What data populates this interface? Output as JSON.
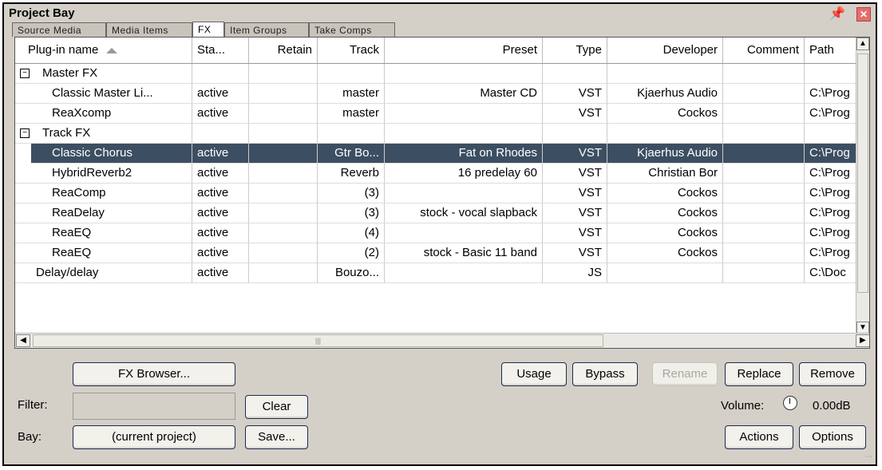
{
  "window": {
    "title": "Project Bay"
  },
  "tabs": [
    "Source Media",
    "Media Items",
    "FX",
    "Item Groups",
    "Take Comps"
  ],
  "columns": [
    "Plug-in name",
    "Sta...",
    "Retain",
    "Track",
    "Preset",
    "Type",
    "Developer",
    "Comment",
    "Path"
  ],
  "rows": [
    {
      "kind": "group",
      "name": "Master FX"
    },
    {
      "kind": "item",
      "name": "Classic Master Li...",
      "status": "active",
      "retain": "",
      "track": "master",
      "preset": "Master CD",
      "type": "VST",
      "developer": "Kjaerhus Audio",
      "comment": "",
      "path": "C:\\Prog"
    },
    {
      "kind": "item",
      "name": "ReaXcomp",
      "status": "active",
      "retain": "",
      "track": "master",
      "preset": "",
      "type": "VST",
      "developer": "Cockos",
      "comment": "",
      "path": "C:\\Prog"
    },
    {
      "kind": "group",
      "name": "Track FX"
    },
    {
      "kind": "item",
      "name": "Classic Chorus",
      "status": "active",
      "retain": "",
      "track": "Gtr Bo...",
      "preset": "Fat on Rhodes",
      "type": "VST",
      "developer": "Kjaerhus Audio",
      "comment": "",
      "path": "C:\\Prog",
      "selected": true
    },
    {
      "kind": "item",
      "name": "HybridReverb2",
      "status": "active",
      "retain": "",
      "track": "Reverb",
      "preset": "16 predelay 60",
      "type": "VST",
      "developer": "Christian Bor",
      "comment": "",
      "path": "C:\\Prog"
    },
    {
      "kind": "item",
      "name": "ReaComp",
      "status": "active",
      "retain": "",
      "track": "(3)",
      "preset": "",
      "type": "VST",
      "developer": "Cockos",
      "comment": "",
      "path": "C:\\Prog"
    },
    {
      "kind": "item",
      "name": "ReaDelay",
      "status": "active",
      "retain": "",
      "track": "(3)",
      "preset": "stock - vocal slapback",
      "type": "VST",
      "developer": "Cockos",
      "comment": "",
      "path": "C:\\Prog"
    },
    {
      "kind": "item",
      "name": "ReaEQ",
      "status": "active",
      "retain": "",
      "track": "(4)",
      "preset": "",
      "type": "VST",
      "developer": "Cockos",
      "comment": "",
      "path": "C:\\Prog"
    },
    {
      "kind": "item",
      "name": "ReaEQ",
      "status": "active",
      "retain": "",
      "track": "(2)",
      "preset": "stock - Basic 11 band",
      "type": "VST",
      "developer": "Cockos",
      "comment": "",
      "path": "C:\\Prog"
    },
    {
      "kind": "item",
      "name": "Delay/delay",
      "status": "active",
      "retain": "",
      "track": "Bouzo...",
      "preset": "",
      "type": "JS",
      "developer": "",
      "comment": "",
      "path": "C:\\Doc",
      "outdent": true
    }
  ],
  "buttons": {
    "fx_browser": "FX Browser...",
    "usage": "Usage",
    "bypass": "Bypass",
    "rename": "Rename",
    "replace": "Replace",
    "remove": "Remove",
    "clear": "Clear",
    "current_project": "(current project)",
    "save": "Save...",
    "actions": "Actions",
    "options": "Options"
  },
  "labels": {
    "filter": "Filter:",
    "bay": "Bay:",
    "volume": "Volume:",
    "volume_value": "0.00dB"
  },
  "icons": {
    "pin": "pin-icon",
    "close": "close-icon",
    "expand": "minus-box-icon",
    "sort": "sort-ascending-icon"
  },
  "colors": {
    "selection": "#3c4e62",
    "close": "#e36d6d",
    "panel": "#d4d0c8"
  }
}
